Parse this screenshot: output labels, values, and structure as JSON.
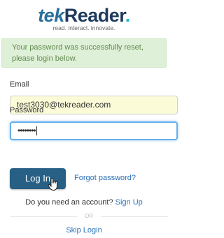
{
  "brand": {
    "tek": "tek",
    "reader": "Reader",
    "dot": ".",
    "tagline": "read. interact. innovate."
  },
  "alert": {
    "message": "Your password was successfully reset, please login below."
  },
  "form": {
    "email_label": "Email",
    "email_value": "test3030@tekreader.com",
    "password_label": "Password",
    "password_mask": "••••••••",
    "login_label": "Log In",
    "forgot_label": "Forgot password?"
  },
  "signup": {
    "prompt": "Do you need an account?",
    "link": "Sign Up"
  },
  "divider": {
    "text": "OR"
  },
  "skip": {
    "label": "Skip Login"
  },
  "colors": {
    "brand_dark": "#1f3a5c",
    "brand_accent": "#20b7c9",
    "button": "#275f85",
    "alert_bg": "#dff0d8"
  }
}
